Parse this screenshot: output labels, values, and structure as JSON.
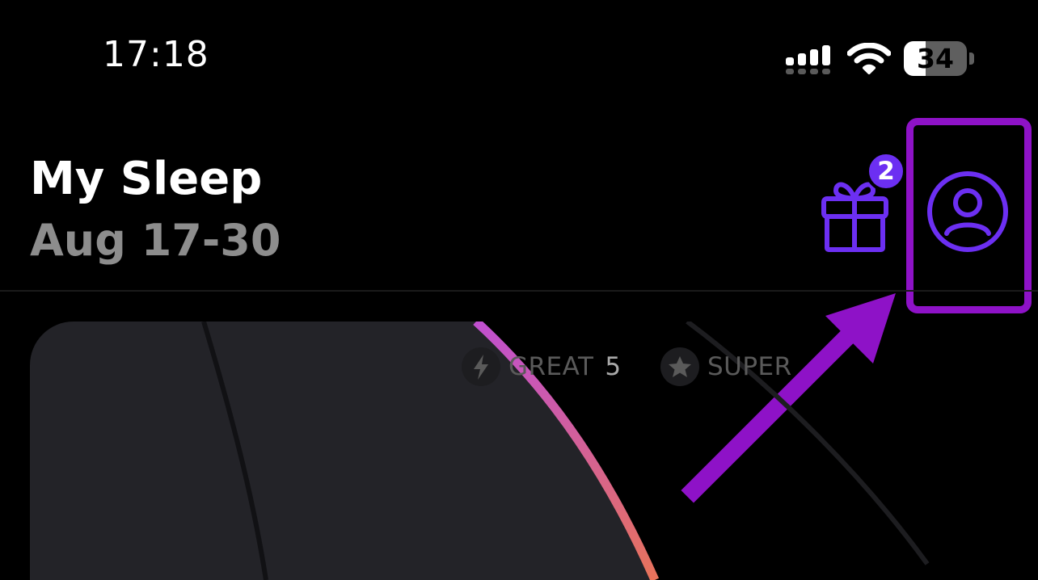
{
  "status_bar": {
    "time": "17:18",
    "battery_percent": "34",
    "battery_level": 0.34
  },
  "header": {
    "title": "My Sleep",
    "date_range": "Aug 17-30"
  },
  "actions": {
    "gift_badge_count": "2",
    "gift_icon": "gift-icon",
    "profile_icon": "profile-icon"
  },
  "filters": [
    {
      "label": "GREAT",
      "count": "5",
      "icon": "lightning-icon"
    },
    {
      "label": "SUPER",
      "count": "",
      "icon": "star-icon"
    }
  ],
  "colors": {
    "accent": "#6c2ff2",
    "annotation": "#8e12c7",
    "card_bg": "#232328",
    "ring_start": "#c04fd0",
    "ring_end": "#e8735a"
  }
}
